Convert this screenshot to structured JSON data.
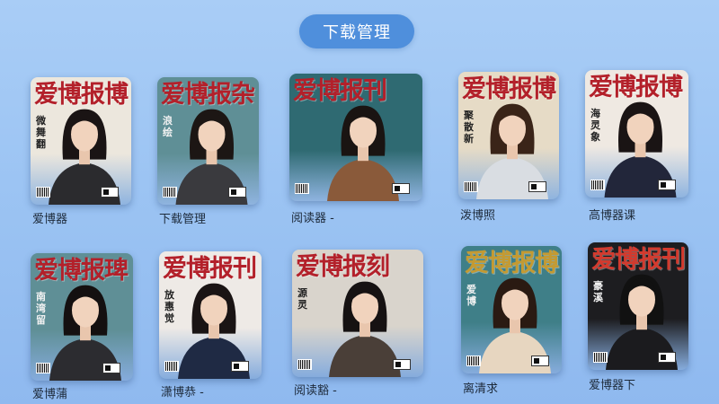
{
  "header": {
    "title": "下载管理"
  },
  "colors": {
    "accent": "#4f8fdc",
    "background": "#9cc4f3"
  },
  "magazines": [
    {
      "masthead": "爱博报博",
      "side_text": "微舞翻",
      "caption": "爱博器",
      "mast_color": "#b3202a",
      "bg": "#ece7dd",
      "outfit": "#2b2b2e",
      "hair": "#1a1414"
    },
    {
      "masthead": "爱博报杂",
      "side_text": "浪绘",
      "caption": "下载管理",
      "mast_color": "#b3202a",
      "bg": "#5f8f96",
      "outfit": "#3a3a3e",
      "hair": "#1c1614"
    },
    {
      "masthead": "爱博报刊",
      "side_text": "",
      "caption": "阅读器 -",
      "mast_color": "#b3202a",
      "bg": "#2f6a72",
      "outfit": "#8a5a3a",
      "hair": "#1a1412"
    },
    {
      "masthead": "爱博报博",
      "side_text": "聚散新",
      "caption": "泼博照",
      "mast_color": "#b3202a",
      "bg": "#e6dbc6",
      "outfit": "#d9dde2",
      "hair": "#3a2418"
    },
    {
      "masthead": "爱博报博",
      "side_text": "海灵象",
      "caption": "高博器课",
      "mast_color": "#b3202a",
      "bg": "#efe9e2",
      "outfit": "#22263a",
      "hair": "#1a1414"
    },
    {
      "masthead": "爱博报琕",
      "side_text": "南湾留",
      "caption": "爱博蒲",
      "mast_color": "#b3202a",
      "bg": "#5f8f96",
      "outfit": "#2c2c30",
      "hair": "#141010"
    },
    {
      "masthead": "爱博报刊",
      "side_text": "放惠觉",
      "caption": "潇博恭 -",
      "mast_color": "#b3202a",
      "bg": "#eeeae6",
      "outfit": "#1f2a44",
      "hair": "#1a1414"
    },
    {
      "masthead": "爱博报刻",
      "side_text": "源灵",
      "caption": "阅读豁 -",
      "mast_color": "#b3202a",
      "bg": "#d9d4cc",
      "outfit": "#4a3f38",
      "hair": "#161212"
    },
    {
      "masthead": "爱博报博",
      "side_text": "爱博",
      "caption": "离清求",
      "mast_color": "#c49a32",
      "bg": "#3f7f88",
      "outfit": "#e7d6c0",
      "hair": "#2a1a12"
    },
    {
      "masthead": "爱博报刊",
      "side_text": "豪溪",
      "caption": "爱博器下",
      "mast_color": "#d33a2e",
      "bg": "#1d1d20",
      "outfit": "#1b1b1e",
      "hair": "#111"
    }
  ]
}
